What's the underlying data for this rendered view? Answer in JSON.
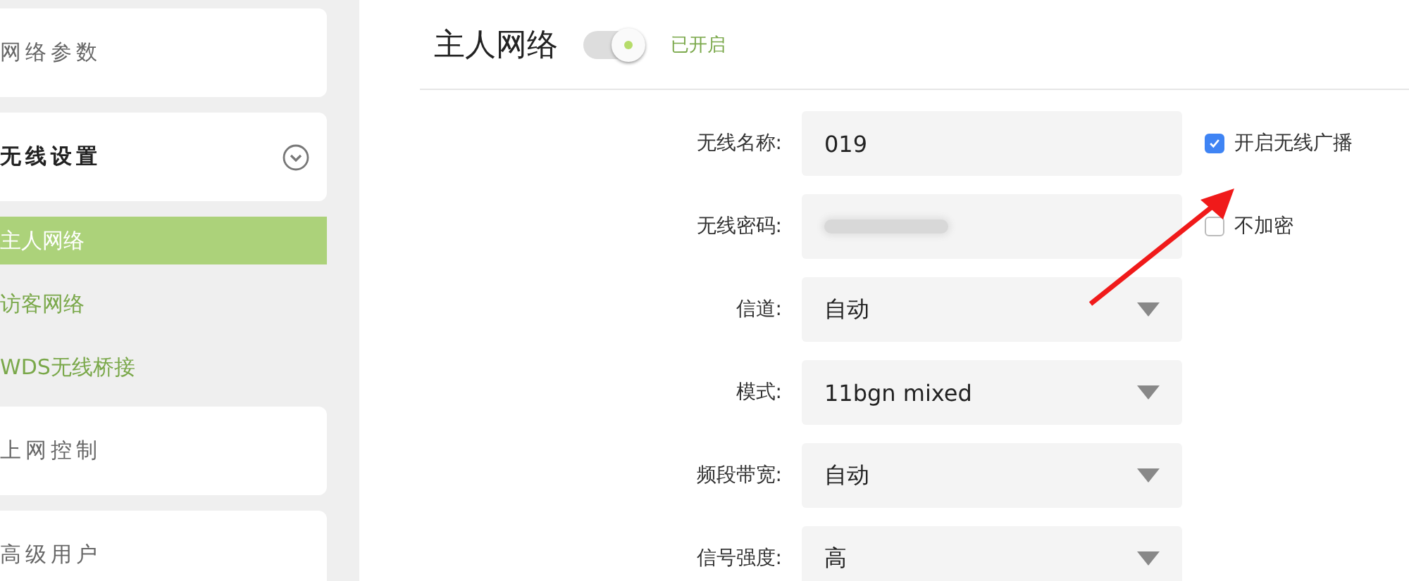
{
  "sidebar": {
    "groups": [
      {
        "label": "网络参数",
        "expanded": false
      },
      {
        "label": "无线设置",
        "expanded": true,
        "children": [
          {
            "label": "主人网络",
            "selected": true
          },
          {
            "label": "访客网络",
            "selected": false
          },
          {
            "label": "WDS无线桥接",
            "selected": false
          }
        ]
      },
      {
        "label": "上网控制",
        "expanded": false
      },
      {
        "label": "高级用户",
        "expanded": false
      }
    ]
  },
  "header": {
    "title": "主人网络",
    "switch": {
      "on": true,
      "status": "已开启"
    }
  },
  "form": {
    "rows": [
      {
        "kind": "text",
        "label": "无线名称:",
        "value": "019",
        "option": {
          "label": "开启无线广播",
          "checked": true
        }
      },
      {
        "kind": "password",
        "label": "无线密码:",
        "option": {
          "label": "不加密",
          "checked": false
        }
      },
      {
        "kind": "select",
        "label": "信道:",
        "value": "自动"
      },
      {
        "kind": "select",
        "label": "模式:",
        "value": "11bgn mixed"
      },
      {
        "kind": "select",
        "label": "频段带宽:",
        "value": "自动"
      },
      {
        "kind": "select",
        "label": "信号强度:",
        "value": "高"
      }
    ]
  },
  "annotation": {
    "kind": "arrow"
  }
}
